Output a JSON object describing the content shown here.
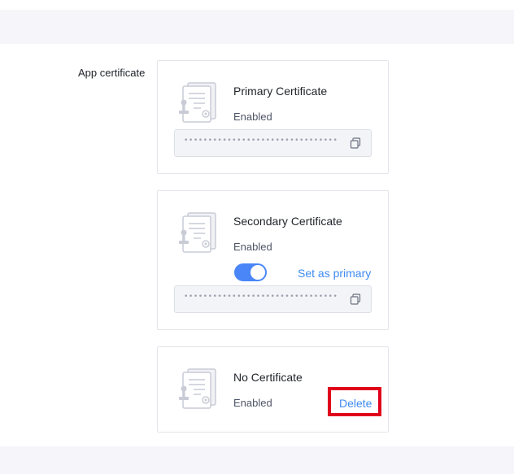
{
  "section": {
    "label": "App certificate"
  },
  "certificates": [
    {
      "title": "Primary Certificate",
      "status": "Enabled",
      "secret_masked": "••••••••••••••••••••••••••••••••"
    },
    {
      "title": "Secondary Certificate",
      "status": "Enabled",
      "toggle_on": true,
      "set_primary_label": "Set as primary",
      "secret_masked": "••••••••••••••••••••••••••••••••"
    },
    {
      "title": "No Certificate",
      "status": "Enabled",
      "delete_label": "Delete"
    }
  ],
  "colors": {
    "accent": "#3d8bf2",
    "toggle_on": "#4a86f7",
    "highlight": "#e0001b",
    "band": "#f6f6fa"
  },
  "icons": {
    "certificate": "certificate-icon",
    "copy": "copy-icon"
  }
}
